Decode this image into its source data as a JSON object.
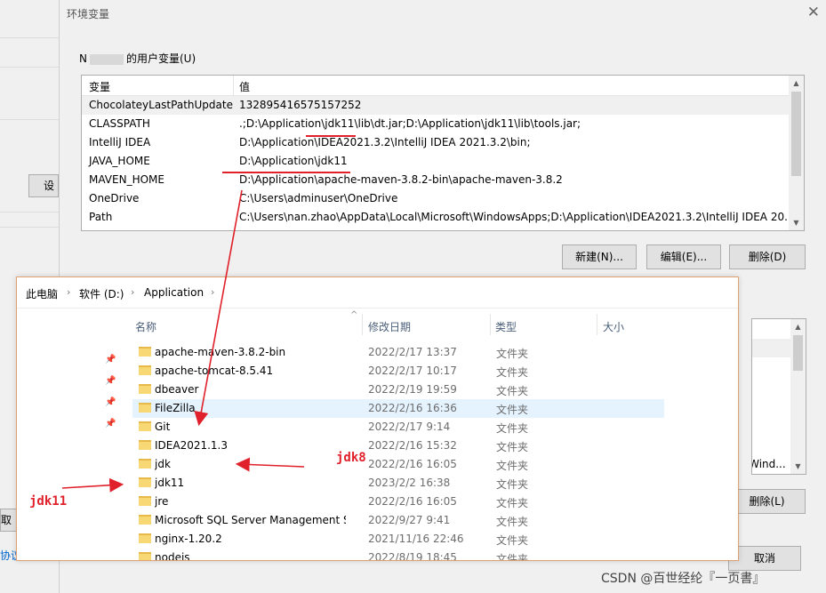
{
  "background_window": {
    "settings_button_label": "设置",
    "cancel_label": "取消",
    "link_text": "协议"
  },
  "dialog": {
    "title": "环境变量",
    "user_group_prefix": "N",
    "user_group_suffix": "的用户变量(U)",
    "columns": {
      "name": "变量",
      "value": "值"
    },
    "variables": [
      {
        "name": "ChocolateyLastPathUpdate",
        "value": "132895416575157252"
      },
      {
        "name": "CLASSPATH",
        "value": ".;D:\\Application\\jdk11\\lib\\dt.jar;D:\\Application\\jdk11\\lib\\tools.jar;"
      },
      {
        "name": "IntelliJ IDEA",
        "value": "D:\\Application\\IDEA2021.3.2\\IntelliJ IDEA 2021.3.2\\bin;"
      },
      {
        "name": "JAVA_HOME",
        "value": "D:\\Application\\jdk11"
      },
      {
        "name": "MAVEN_HOME",
        "value": "D:\\Application\\apache-maven-3.8.2-bin\\apache-maven-3.8.2"
      },
      {
        "name": "OneDrive",
        "value": "C:\\Users\\adminuser\\OneDrive"
      },
      {
        "name": "Path",
        "value": "C:\\Users\\nan.zhao\\AppData\\Local\\Microsoft\\WindowsApps;D:\\Application\\IDEA2021.3.2\\IntelliJ IDEA 20..."
      }
    ],
    "buttons": {
      "new": "新建(N)...",
      "edit": "编辑(E)...",
      "delete": "删除(D)"
    },
    "system_path_fragment": ":\\Wind...",
    "system_delete": "删除(L)",
    "cancel": "取消"
  },
  "explorer": {
    "breadcrumb": [
      "此电脑",
      "软件 (D:)",
      "Application"
    ],
    "columns": {
      "name": "名称",
      "date": "修改日期",
      "type": "类型",
      "size": "大小"
    },
    "files": [
      {
        "name": "apache-maven-3.8.2-bin",
        "date": "2022/2/17 13:37",
        "type": "文件夹"
      },
      {
        "name": "apache-tomcat-8.5.41",
        "date": "2022/2/17 10:17",
        "type": "文件夹"
      },
      {
        "name": "dbeaver",
        "date": "2022/2/19 19:59",
        "type": "文件夹"
      },
      {
        "name": "FileZilla",
        "date": "2022/2/16 16:36",
        "type": "文件夹"
      },
      {
        "name": "Git",
        "date": "2022/2/17 9:14",
        "type": "文件夹"
      },
      {
        "name": "IDEA2021.1.3",
        "date": "2022/2/16 15:32",
        "type": "文件夹"
      },
      {
        "name": "jdk",
        "date": "2022/2/16 16:05",
        "type": "文件夹"
      },
      {
        "name": "jdk11",
        "date": "2023/2/2 16:38",
        "type": "文件夹"
      },
      {
        "name": "jre",
        "date": "2022/2/16 16:05",
        "type": "文件夹"
      },
      {
        "name": "Microsoft SQL Server Management S...",
        "date": "2022/9/27 9:41",
        "type": "文件夹"
      },
      {
        "name": "nginx-1.20.2",
        "date": "2021/11/16 22:46",
        "type": "文件夹"
      },
      {
        "name": "nodejs",
        "date": "2022/8/19 18:45",
        "type": "文件夹"
      }
    ]
  },
  "annotations": {
    "jdk8": "jdk8",
    "jdk11": "jdk11",
    "color": "#e0202a"
  },
  "watermark": "CSDN @百世经纶『一页書』",
  "accent": {
    "selection": "#e5f3ff",
    "folder": "#f8d775"
  }
}
